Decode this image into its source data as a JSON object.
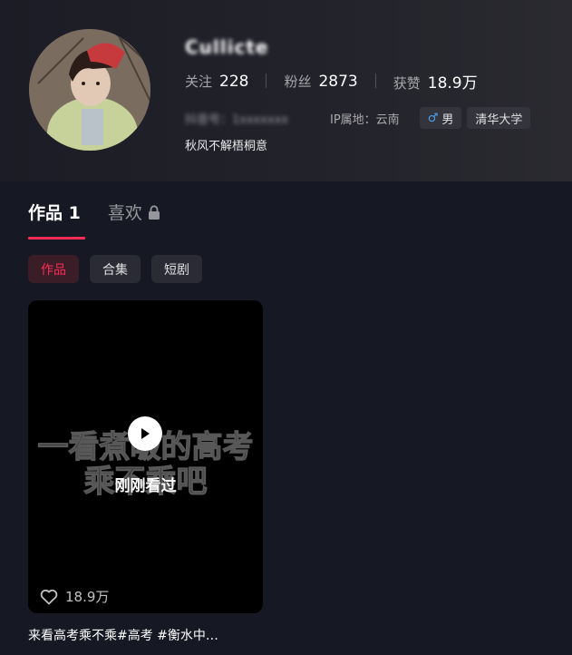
{
  "profile": {
    "username": "Cullicte",
    "blurred_id": "抖音号：1xxxxxxx",
    "ip_location": "IP属地：云南",
    "gender_label": "男",
    "school_tag": "清华大学",
    "signature": "秋风不解梧桐意"
  },
  "stats": [
    {
      "label": "关注",
      "value": "228"
    },
    {
      "label": "粉丝",
      "value": "2873"
    },
    {
      "label": "获赞",
      "value": "18.9万"
    }
  ],
  "tabs": {
    "works_label": "作品 1",
    "likes_label": "喜欢"
  },
  "filters": [
    "作品",
    "合集",
    "短剧"
  ],
  "video": {
    "overlay_line1": "一看煮啵的高考",
    "overlay_line2": "乘不乘吧",
    "watched_label": "刚刚看过",
    "like_count": "18.9万",
    "caption": "来看高考乘不乘#高考 #衡水中…"
  },
  "colors": {
    "accent": "#fe2c55",
    "background": "#161823",
    "male_blue": "#4aa3f0"
  }
}
